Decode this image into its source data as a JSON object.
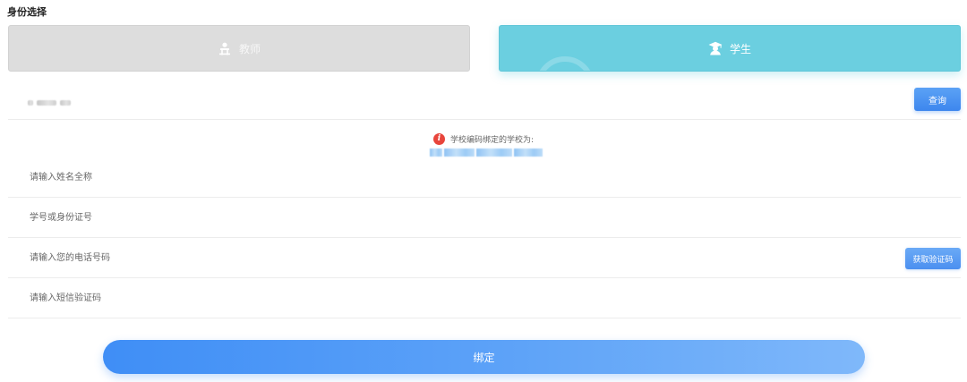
{
  "section": {
    "title": "身份选择"
  },
  "roles": {
    "teacher": {
      "label": "教师",
      "icon": "teacher-icon",
      "selected": false
    },
    "student": {
      "label": "学生",
      "icon": "student-graduation-icon",
      "selected": true
    }
  },
  "school": {
    "query_label": "查询",
    "notice": "学校编码绑定的学校为:"
  },
  "fields": {
    "name_placeholder": "请输入姓名全称",
    "id_placeholder": "学号或身份证号",
    "phone_placeholder": "请输入您的电话号码",
    "sms_placeholder": "请输入短信验证码",
    "get_code_label": "获取验证码"
  },
  "actions": {
    "bind_label": "绑定"
  },
  "colors": {
    "student_active": "#6bcfe0",
    "teacher_inactive": "#dddddd",
    "primary_blue": "#3d86ee",
    "warning_red": "#e8453c"
  }
}
